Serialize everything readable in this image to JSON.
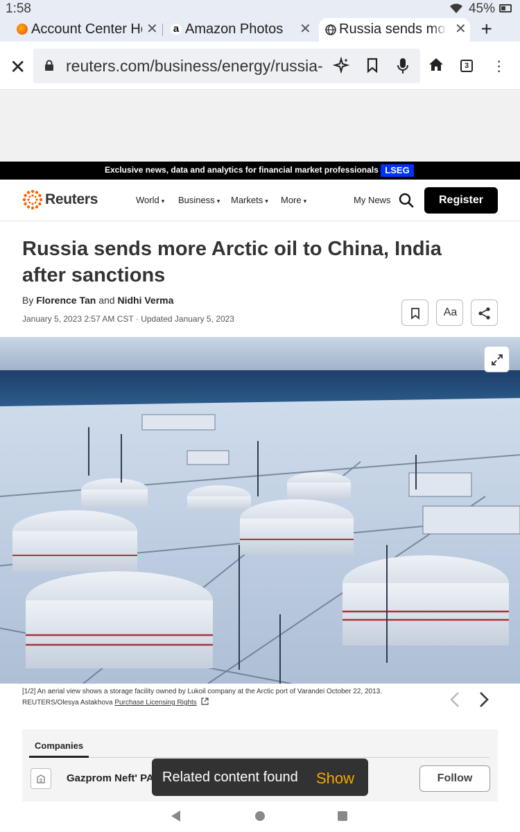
{
  "status_bar": {
    "time": "1:58",
    "battery": "45%"
  },
  "tabs": [
    {
      "title": "Account Center Ho",
      "icon": "firefox-icon"
    },
    {
      "title": "Amazon Photos",
      "icon": "amazon-icon"
    },
    {
      "title": "Russia sends more",
      "icon": "globe-icon",
      "active": true
    }
  ],
  "address_bar": {
    "url": "reuters.com/business/energy/russia-",
    "tab_count": "3"
  },
  "promo_banner": {
    "text": "Exclusive news, data and analytics for financial market professionals",
    "badge": "LSEG"
  },
  "site_nav": {
    "logo_text": "Reuters",
    "items": [
      "World",
      "Business",
      "Markets",
      "More"
    ],
    "my_news": "My News",
    "register": "Register"
  },
  "article": {
    "headline": "Russia sends more Arctic oil to China, India after sanctions",
    "by": "By",
    "author1": "Florence Tan",
    "and": "and",
    "author2": "Nidhi Verma",
    "date": "January 5, 2023 2:57 AM CST · Updated January 5, 2023",
    "font_button": "Aa"
  },
  "photo": {
    "counter": "[1/2]",
    "caption": "An aerial view shows a storage facility owned by Lukoil company at the Arctic port of Varandei October 22, 2013.",
    "credit": "REUTERS/Olesya Astakhova",
    "license": "Purchase Licensing Rights"
  },
  "companies": {
    "tab": "Companies",
    "name": "Gazprom Neft' PA",
    "follow": "Follow"
  },
  "snackbar": {
    "message": "Related content found",
    "action": "Show"
  }
}
